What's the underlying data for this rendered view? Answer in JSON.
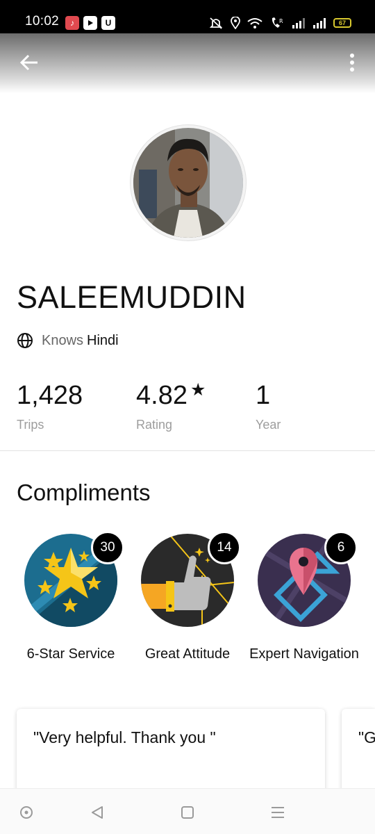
{
  "status_bar": {
    "time": "10:02",
    "battery": "67",
    "app_icons": [
      "music-app-icon",
      "youtube-app-icon",
      "uber-app-icon"
    ],
    "system_icons": [
      "mute-icon",
      "location-icon",
      "wifi-icon",
      "volte-icon",
      "signal-icon",
      "signal-icon"
    ]
  },
  "toolbar": {
    "back_icon": "back-arrow-icon",
    "more_icon": "more-vertical-icon"
  },
  "profile": {
    "name": "SALEEMUDDIN",
    "language_prefix": "Knows",
    "language": "Hindi",
    "stats": [
      {
        "value": "1,428",
        "label": "Trips"
      },
      {
        "value": "4.82",
        "star": "★",
        "label": "Rating"
      },
      {
        "value": "1",
        "label": "Year"
      }
    ]
  },
  "compliments": {
    "title": "Compliments",
    "items": [
      {
        "count": "30",
        "label": "6-Star Service",
        "icon": "six-star-service-icon"
      },
      {
        "count": "14",
        "label": "Great Attitude",
        "icon": "thumbs-up-icon"
      },
      {
        "count": "6",
        "label": "Expert Navigation",
        "icon": "map-pin-icon"
      }
    ]
  },
  "reviews": [
    {
      "text": "\"Very helpful. Thank you \""
    },
    {
      "text": "\"G"
    }
  ],
  "nav_bar": {
    "icons": [
      "home-circle-icon",
      "back-triangle-icon",
      "recents-square-icon",
      "menu-lines-icon"
    ]
  },
  "colors": {
    "status_bar": "#000000",
    "battery": "#d8c92f",
    "badge_star_bg": "#1c6d8f",
    "badge_thumb_bg": "#2a2a2a",
    "badge_nav_bg": "#3a2f4f",
    "accent_gold": "#f5c518",
    "pin_pink": "#e9738e",
    "route_blue": "#3ba3d6"
  }
}
